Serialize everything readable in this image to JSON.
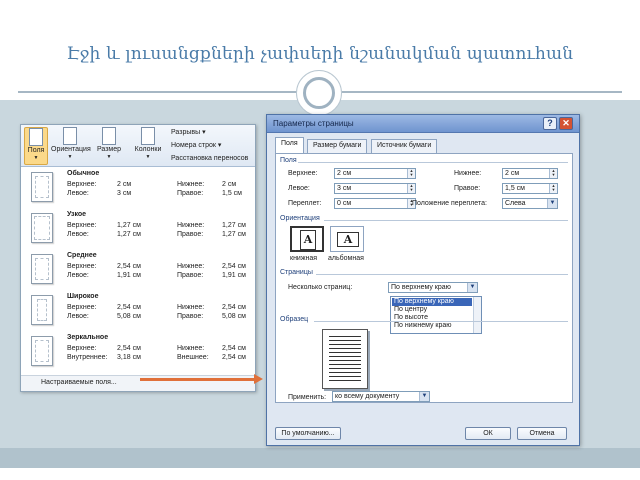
{
  "slide": {
    "title": "Էջի և լուսանցքների չափսերի նշանակման պատուհան"
  },
  "ribbon": {
    "buttons": [
      {
        "label": "Поля"
      },
      {
        "label": "Ориентация"
      },
      {
        "label": "Размер"
      },
      {
        "label": "Колонки"
      }
    ],
    "side_items": [
      "Разрывы ▾",
      "Номера строк ▾",
      "Расстановка переносов"
    ]
  },
  "margins_menu": {
    "presets": [
      {
        "name": "Обычное",
        "r1": [
          "Верхнее:",
          "2 см",
          "Нижнее:",
          "2 см"
        ],
        "r2": [
          "Левое:",
          "3 см",
          "Правое:",
          "1,5 см"
        ]
      },
      {
        "name": "Узкое",
        "r1": [
          "Верхнее:",
          "1,27 см",
          "Нижнее:",
          "1,27 см"
        ],
        "r2": [
          "Левое:",
          "1,27 см",
          "Правое:",
          "1,27 см"
        ]
      },
      {
        "name": "Среднее",
        "r1": [
          "Верхнее:",
          "2,54 см",
          "Нижнее:",
          "2,54 см"
        ],
        "r2": [
          "Левое:",
          "1,91 см",
          "Правое:",
          "1,91 см"
        ]
      },
      {
        "name": "Широкое",
        "r1": [
          "Верхнее:",
          "2,54 см",
          "Нижнее:",
          "2,54 см"
        ],
        "r2": [
          "Левое:",
          "5,08 см",
          "Правое:",
          "5,08 см"
        ]
      },
      {
        "name": "Зеркальное",
        "r1": [
          "Верхнее:",
          "2,54 см",
          "Нижнее:",
          "2,54 см"
        ],
        "r2": [
          "Внутреннее:",
          "3,18 см",
          "Внешнее:",
          "2,54 см"
        ]
      }
    ],
    "custom_label": "Настраиваемые поля..."
  },
  "dialog": {
    "title": "Параметры страницы",
    "help_label": "?",
    "close_label": "✕",
    "tabs": [
      "Поля",
      "Размер бумаги",
      "Источник бумаги"
    ],
    "fields_group": "Поля",
    "top_label": "Верхнее:",
    "top_value": "2 см",
    "bottom_label": "Нижнее:",
    "bottom_value": "2 см",
    "left_label": "Левое:",
    "left_value": "3 см",
    "right_label": "Правое:",
    "right_value": "1,5 см",
    "gutter_label": "Переплет:",
    "gutter_value": "0 см",
    "gutter_pos_label": "Положение переплета:",
    "gutter_pos_value": "Слева",
    "orientation_group": "Ориентация",
    "portrait_label": "книжная",
    "landscape_label": "альбомная",
    "pages_group": "Страницы",
    "multiple_pages_label": "Несколько страниц:",
    "multiple_pages_value": "По верхнему краю",
    "multiple_pages_options": [
      "По верхнему краю",
      "По центру",
      "По высоте",
      "По нижнему краю"
    ],
    "sample_group": "Образец",
    "apply_label": "Применить:",
    "apply_value": "ко всему документу",
    "default_button": "По умолчанию...",
    "ok_button": "ОК",
    "cancel_button": "Отмена"
  },
  "colors": {
    "title": "#4a7ba8",
    "arrow": "#e0703a",
    "selection": "#3a66b8"
  }
}
